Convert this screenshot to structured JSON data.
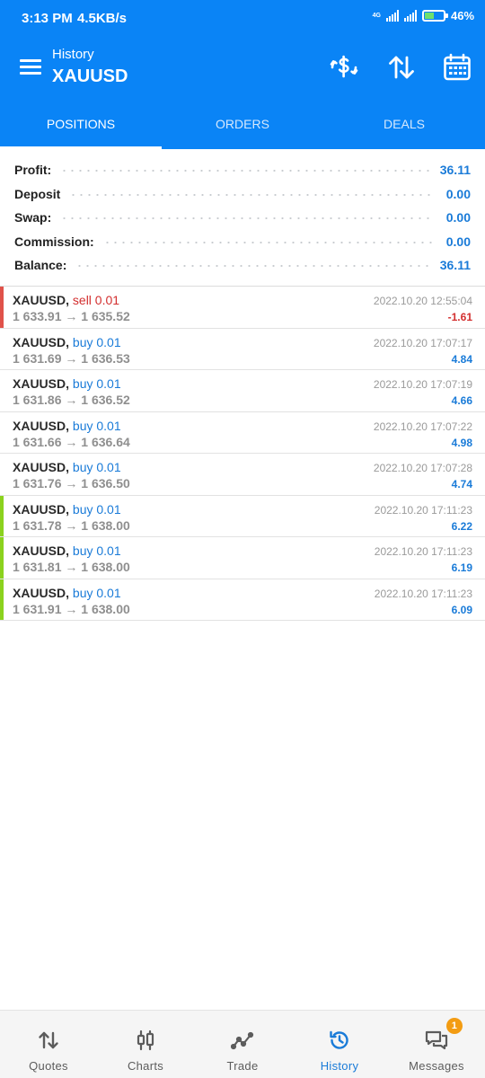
{
  "status_bar": {
    "time": "3:13 PM",
    "speed": "4.5KB/s",
    "network": "4G",
    "battery": "46"
  },
  "header": {
    "subtitle": "History",
    "title": "XAUUSD"
  },
  "tabs": [
    {
      "label": "POSITIONS",
      "active": true
    },
    {
      "label": "ORDERS",
      "active": false
    },
    {
      "label": "DEALS",
      "active": false
    }
  ],
  "summary": [
    {
      "label": "Profit:",
      "value": "36.11"
    },
    {
      "label": "Deposit",
      "value": "0.00"
    },
    {
      "label": "Swap:",
      "value": "0.00"
    },
    {
      "label": "Commission:",
      "value": "0.00"
    },
    {
      "label": "Balance:",
      "value": "36.11"
    }
  ],
  "deals": [
    {
      "symbol": "XAUUSD,",
      "side": "sell 0.01",
      "prices": "1 633.91 → 1 635.52",
      "time": "2022.10.20 12:55:04",
      "profit": "-1.61",
      "bar": "red"
    },
    {
      "symbol": "XAUUSD,",
      "side": "buy 0.01",
      "prices": "1 631.69 → 1 636.53",
      "time": "2022.10.20 17:07:17",
      "profit": "4.84",
      "bar": "none"
    },
    {
      "symbol": "XAUUSD,",
      "side": "buy 0.01",
      "prices": "1 631.86 → 1 636.52",
      "time": "2022.10.20 17:07:19",
      "profit": "4.66",
      "bar": "none"
    },
    {
      "symbol": "XAUUSD,",
      "side": "buy 0.01",
      "prices": "1 631.66 → 1 636.64",
      "time": "2022.10.20 17:07:22",
      "profit": "4.98",
      "bar": "none"
    },
    {
      "symbol": "XAUUSD,",
      "side": "buy 0.01",
      "prices": "1 631.76 → 1 636.50",
      "time": "2022.10.20 17:07:28",
      "profit": "4.74",
      "bar": "none"
    },
    {
      "symbol": "XAUUSD,",
      "side": "buy 0.01",
      "prices": "1 631.78 → 1 638.00",
      "time": "2022.10.20 17:11:23",
      "profit": "6.22",
      "bar": "green"
    },
    {
      "symbol": "XAUUSD,",
      "side": "buy 0.01",
      "prices": "1 631.81 → 1 638.00",
      "time": "2022.10.20 17:11:23",
      "profit": "6.19",
      "bar": "green"
    },
    {
      "symbol": "XAUUSD,",
      "side": "buy 0.01",
      "prices": "1 631.91 → 1 638.00",
      "time": "2022.10.20 17:11:23",
      "profit": "6.09",
      "bar": "green"
    }
  ],
  "bottom_nav": [
    {
      "label": "Quotes",
      "icon": "quotes-icon",
      "active": false
    },
    {
      "label": "Charts",
      "icon": "charts-icon",
      "active": false
    },
    {
      "label": "Trade",
      "icon": "trade-icon",
      "active": false
    },
    {
      "label": "History",
      "icon": "history-icon",
      "active": true
    },
    {
      "label": "Messages",
      "icon": "messages-icon",
      "active": false,
      "badge": "1"
    }
  ],
  "colors": {
    "brand_blue": "#0a84f6",
    "sell_red": "#d32f2f",
    "buy_blue": "#1a7bd8",
    "loss_bar": "#e0524a",
    "profit_bar": "#8bd21e",
    "active_nav": "#1a7bd8"
  }
}
